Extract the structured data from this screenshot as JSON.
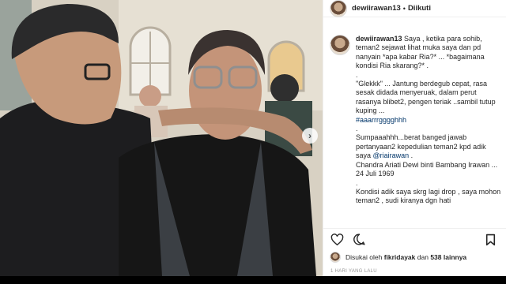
{
  "post": {
    "username": "dewiirawan13",
    "header_separator": "•",
    "follow_status": "Diikuti",
    "caption": {
      "line1_after_name": "Saya , ketika para sohib, teman2 sejawat lihat muka saya dan pd nanyain *apa kabar Ria?* ... *bagaimana kondisi Ria skarang?* .",
      "dot1": ".",
      "para2": "\"Glekkk\" ... Jantung berdegub cepat, rasa sesak didada menyeruak, dalam perut rasanya blibet2, pengen teriak ..sambil tutup kuping ...",
      "hashtag": "#aaarrrgggghhh",
      "hashtag_dot": ".",
      "para3_pre": "Sumpaaahhh...berat banged jawab pertanyaan2 kepedulian teman2 kpd adik saya ",
      "mention": "@riairawan",
      "para3_post": " .",
      "para4": "Chandra Ariati Dewi binti Bambang Irawan ... 24 Juli 1969",
      "dot2": ".",
      "para5": "Kondisi adik saya skrg lagi drop , saya mohon teman2 , sudi kiranya dgn hati"
    },
    "likes": {
      "prefix": "Disukai oleh",
      "user": "fikridayak",
      "middle": "dan",
      "count": "538 lainnya"
    },
    "timestamp": "1 HARI YANG LALU"
  },
  "icons": {
    "like": "heart-icon",
    "comment": "comment-icon",
    "save": "bookmark-icon",
    "next": "chevron-right-icon"
  },
  "colors": {
    "link": "#003569",
    "text": "#262626",
    "divider": "#efefef"
  }
}
